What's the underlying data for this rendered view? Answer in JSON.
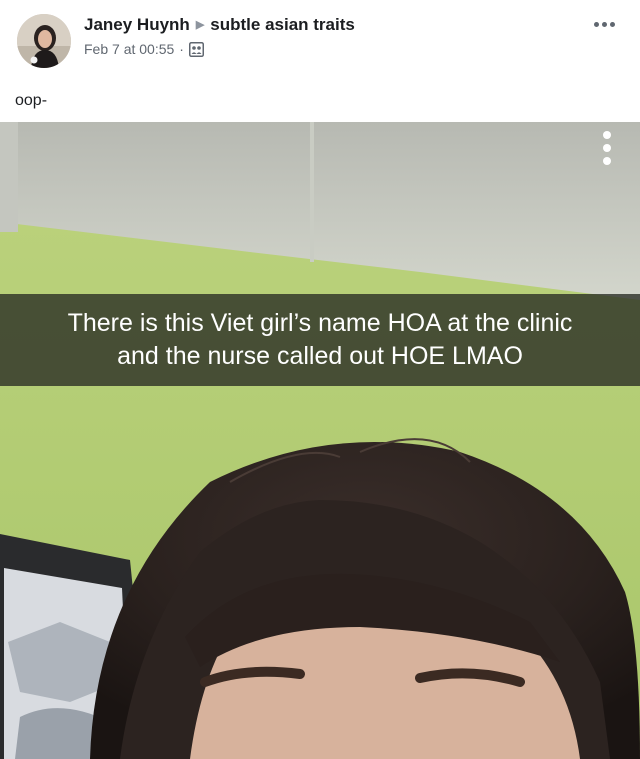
{
  "post": {
    "author": "Janey Huynh",
    "group": "subtle asian traits",
    "timestamp": "Feb 7 at 00:55",
    "separator": "·",
    "privacy_icon": "group-members-icon",
    "more_icon": "more-options-icon",
    "text": "oop-"
  },
  "photo": {
    "caption_lines": [
      "There is this Viet girl’s name HOA at the clinic",
      "and the nurse called out HOE LMAO"
    ],
    "menu_icon": "vertical-dots-icon"
  },
  "colors": {
    "author_text": "#1c1e21",
    "meta_text": "#606770",
    "caption_bg": "#282a22",
    "wall_green": "#b9d17a"
  }
}
